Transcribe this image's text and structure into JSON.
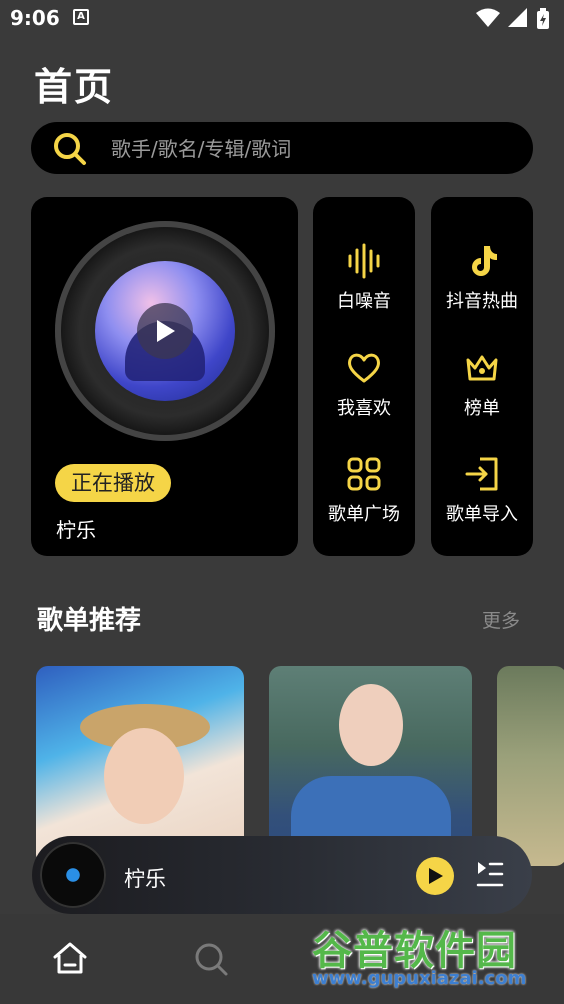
{
  "status_bar": {
    "time": "9:06",
    "app_icon": "A"
  },
  "page_title": "首页",
  "search": {
    "placeholder": "歌手/歌名/专辑/歌词"
  },
  "now_playing_card": {
    "badge": "正在播放",
    "song_title": "柠乐"
  },
  "quick_tiles": [
    {
      "label": "白噪音",
      "icon": "waveform-icon"
    },
    {
      "label": "抖音热曲",
      "icon": "tiktok-note-icon"
    },
    {
      "label": "我喜欢",
      "icon": "heart-icon"
    },
    {
      "label": "榜单",
      "icon": "crown-icon"
    },
    {
      "label": "歌单广场",
      "icon": "grid-icon"
    },
    {
      "label": "歌单导入",
      "icon": "import-icon"
    }
  ],
  "playlist_section": {
    "title": "歌单推荐",
    "more_label": "更多"
  },
  "mini_player": {
    "song_title": "柠乐"
  },
  "accent_color": "#f5d547",
  "watermark": {
    "brand": "谷普软件园",
    "url": "www.gupuxiazai.com"
  }
}
